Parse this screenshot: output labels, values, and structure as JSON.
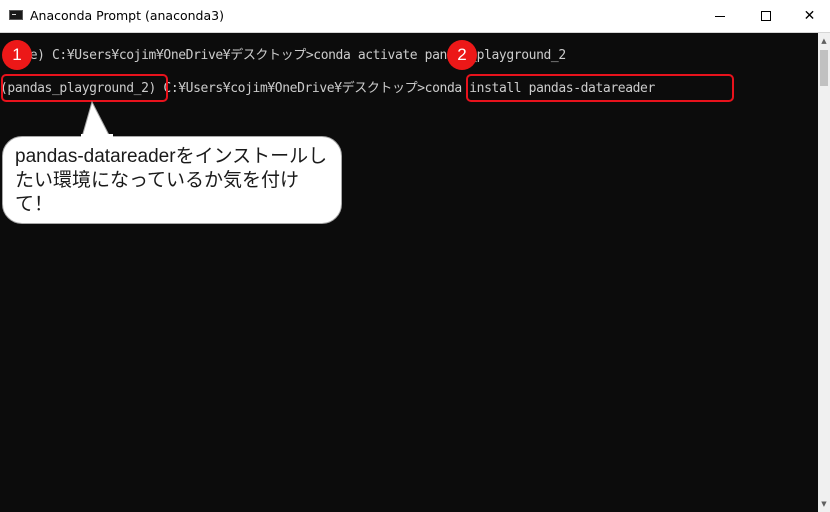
{
  "window": {
    "title": "Anaconda Prompt (anaconda3)",
    "minimize_glyph": "",
    "maximize_glyph": "",
    "close_glyph": "✕",
    "app_icon": "console-icon"
  },
  "console": {
    "line1": {
      "env": "(base)",
      "path": " C:¥Users¥cojim¥OneDrive¥デスクトップ>",
      "command": "conda activate pandas_playground_2"
    },
    "line2": {
      "env": "(pandas_playground_2)",
      "path": " C:¥Users¥cojim¥OneDrive¥デスクトップ>",
      "command": "conda install pandas-datareader"
    }
  },
  "annotations": {
    "badge_1": "1",
    "badge_2": "2",
    "callout": "pandas-datareaderをインストールしたい環境になっているか気を付けて！",
    "highlight_color": "#e8121c",
    "badge_color": "#ec1818"
  },
  "scrollbar": {
    "up_glyph": "▲",
    "down_glyph": "▼"
  }
}
